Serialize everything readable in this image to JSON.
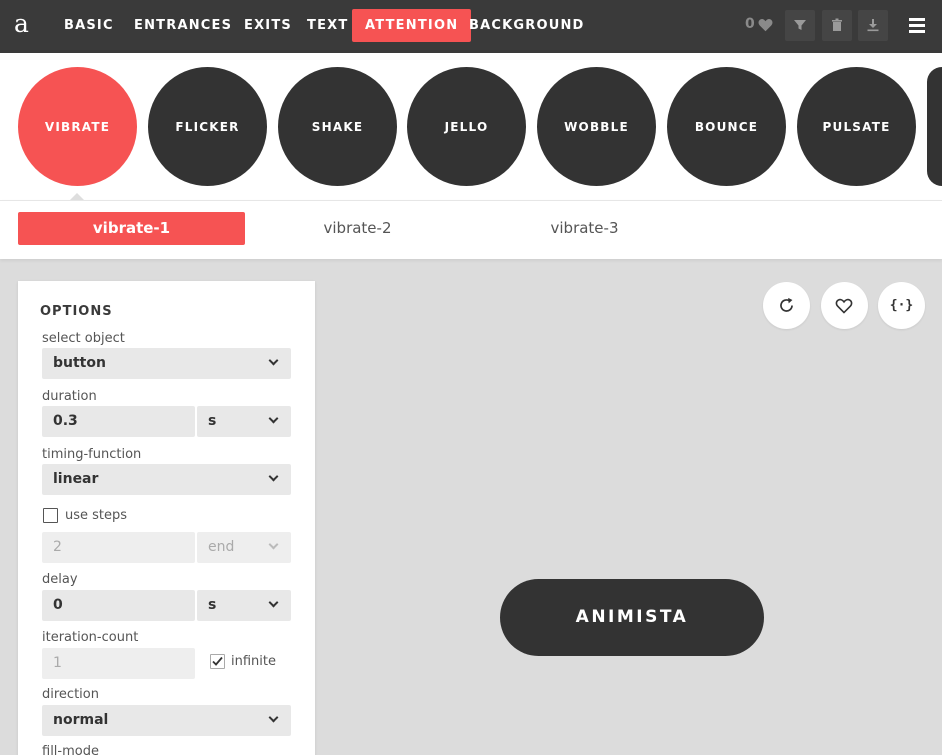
{
  "app": {
    "logo": "a"
  },
  "nav": {
    "items": [
      "BASIC",
      "ENTRANCES",
      "EXITS",
      "TEXT",
      "ATTENTION",
      "BACKGROUND"
    ],
    "active": "ATTENTION",
    "favorites_count": "0"
  },
  "animations": {
    "items": [
      "VIBRATE",
      "FLICKER",
      "SHAKE",
      "JELLO",
      "WOBBLE",
      "BOUNCE",
      "PULSATE"
    ],
    "active": "VIBRATE"
  },
  "variants": {
    "items": [
      "vibrate-1",
      "vibrate-2",
      "vibrate-3"
    ],
    "active": "vibrate-1"
  },
  "options": {
    "title": "OPTIONS",
    "select_object": {
      "label": "select object",
      "value": "button"
    },
    "duration": {
      "label": "duration",
      "value": "0.3",
      "unit": "s"
    },
    "timing_function": {
      "label": "timing-function",
      "value": "linear"
    },
    "use_steps": {
      "label": "use steps",
      "checked": false,
      "steps": "2",
      "position": "end"
    },
    "delay": {
      "label": "delay",
      "value": "0",
      "unit": "s"
    },
    "iteration_count": {
      "label": "iteration-count",
      "value": "1",
      "infinite_label": "infinite",
      "infinite_checked": true
    },
    "direction": {
      "label": "direction",
      "value": "normal"
    },
    "fill_mode": {
      "label": "fill-mode"
    }
  },
  "preview": {
    "demo_label": "ANIMISTA",
    "code_glyph": "{·}"
  },
  "colors": {
    "accent": "#f65353",
    "dark": "#333333",
    "topbar": "#3a3a3a",
    "background": "#dcdcdc"
  }
}
